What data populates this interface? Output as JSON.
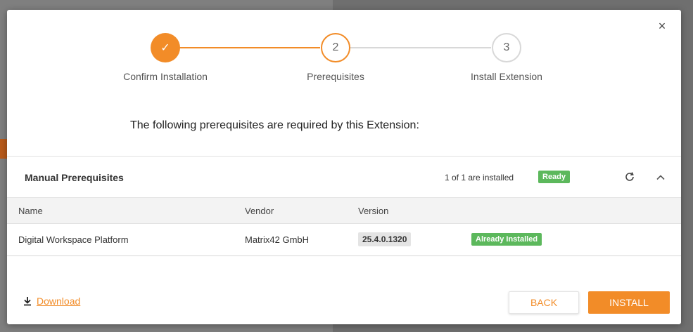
{
  "dialog": {
    "close_label": "×"
  },
  "stepper": {
    "steps": [
      {
        "number": "✓",
        "label": "Confirm Installation",
        "state": "done"
      },
      {
        "number": "2",
        "label": "Prerequisites",
        "state": "active"
      },
      {
        "number": "3",
        "label": "Install Extension",
        "state": "pending"
      }
    ]
  },
  "intro_text": "The following prerequisites are required by this Extension:",
  "section": {
    "title": "Manual Prerequisites",
    "installed_count": "1 of 1 are installed",
    "status_badge": "Ready"
  },
  "table": {
    "columns": [
      "Name",
      "Vendor",
      "Version"
    ],
    "rows": [
      {
        "name": "Digital Workspace Platform",
        "vendor": "Matrix42 GmbH",
        "version": "25.4.0.1320",
        "status": "Already Installed"
      }
    ]
  },
  "footer": {
    "download_label": "Download",
    "back_label": "BACK",
    "install_label": "INSTALL"
  },
  "colors": {
    "accent": "#f28c28",
    "success": "#5cb85c"
  }
}
